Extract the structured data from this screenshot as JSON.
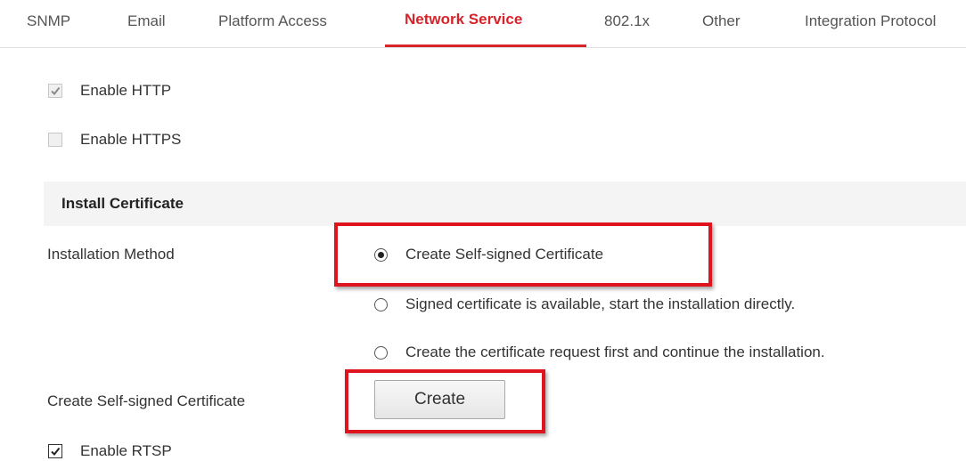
{
  "tabs": [
    {
      "label": "SNMP",
      "active": false
    },
    {
      "label": "Email",
      "active": false
    },
    {
      "label": "Platform Access",
      "active": false
    },
    {
      "label": "Network Service",
      "active": true
    },
    {
      "label": "802.1x",
      "active": false
    },
    {
      "label": "Other",
      "active": false
    },
    {
      "label": "Integration Protocol",
      "active": false
    }
  ],
  "http": {
    "label": "Enable HTTP",
    "checked": true,
    "disabled": true
  },
  "https": {
    "label": "Enable HTTPS",
    "checked": false,
    "disabled": true
  },
  "install_certificate": {
    "section_title": "Install Certificate",
    "method_label": "Installation Method",
    "options": [
      {
        "label": "Create Self-signed Certificate",
        "selected": true
      },
      {
        "label": "Signed certificate is available, start the installation directly.",
        "selected": false
      },
      {
        "label": "Create the certificate request first and continue the installation.",
        "selected": false
      }
    ],
    "create_label": "Create Self-signed Certificate",
    "create_button": "Create"
  },
  "rtsp": {
    "label": "Enable RTSP",
    "checked": true,
    "disabled": false
  },
  "colors": {
    "accent": "#d7242a",
    "highlight_box": "#e0141e"
  }
}
